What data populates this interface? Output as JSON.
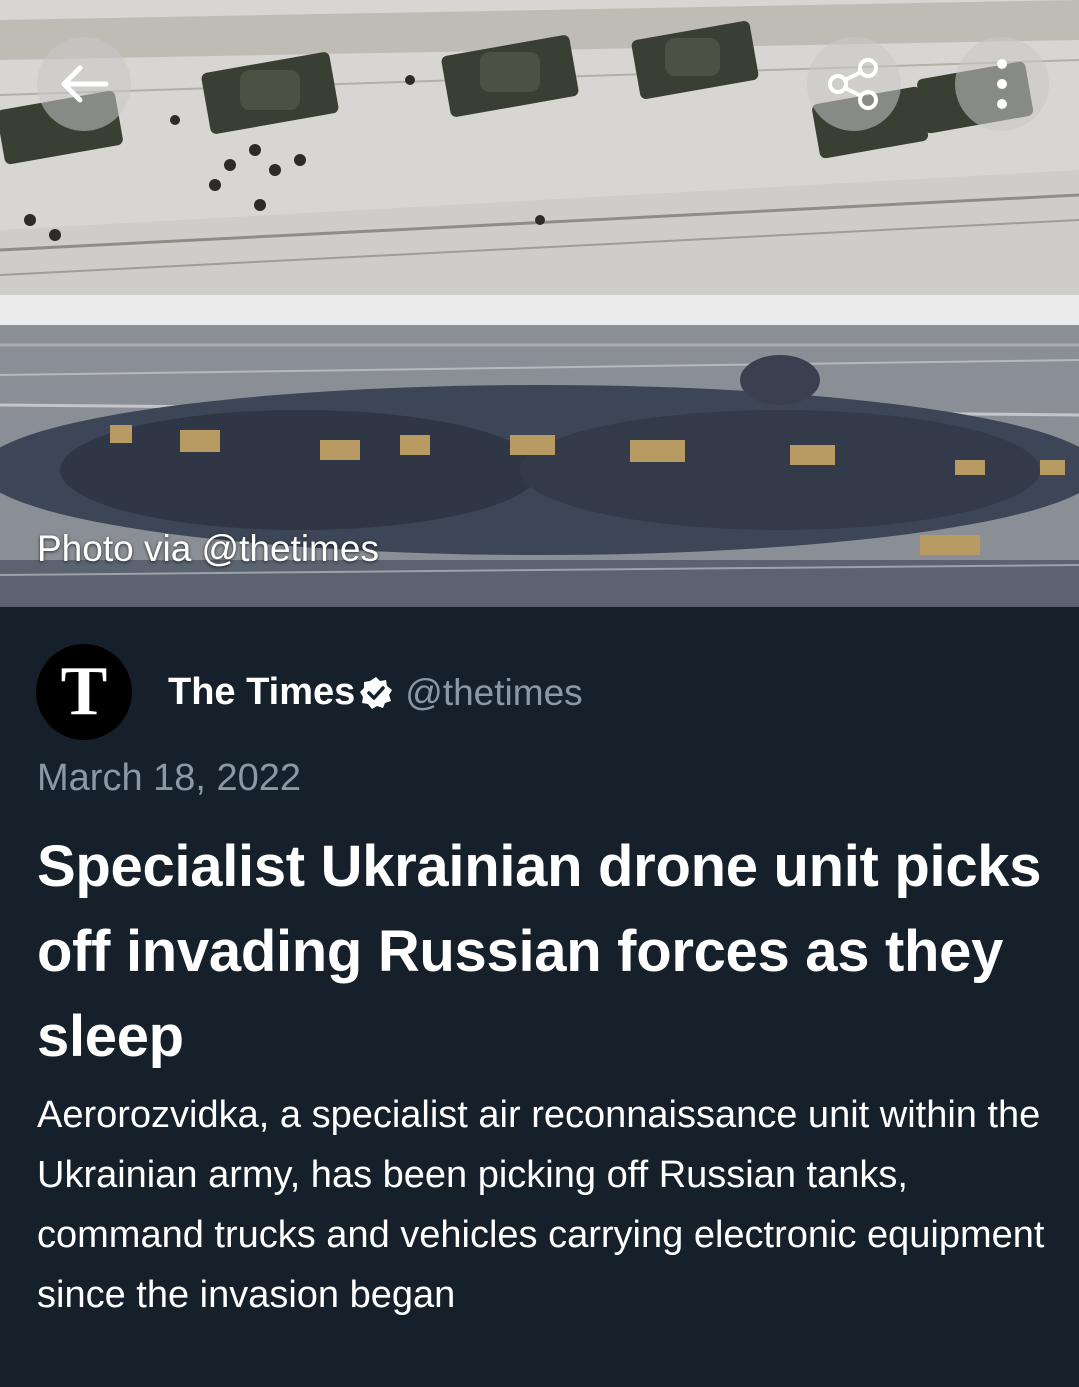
{
  "hero": {
    "caption": "Photo via @thetimes",
    "buttons": {
      "back_icon": "arrow-left-icon",
      "share_icon": "share-icon",
      "more_icon": "more-vertical-icon"
    }
  },
  "article": {
    "avatar_letter": "T",
    "author_name": "The Times",
    "verified_icon": "verified-badge-icon",
    "author_handle": "@thetimes",
    "date": "March 18, 2022",
    "headline": "Specialist Ukrainian drone unit picks off invading Russian forces as they sleep",
    "summary": "Aerorozvidka, a specialist air reconnaissance unit within the Ukrainian army, has been picking off Russian tanks, command trucks and vehicles carrying electronic equipment since the invasion began"
  },
  "colors": {
    "background": "#15202b",
    "text_primary": "#ffffff",
    "text_secondary": "#8b98a5"
  }
}
